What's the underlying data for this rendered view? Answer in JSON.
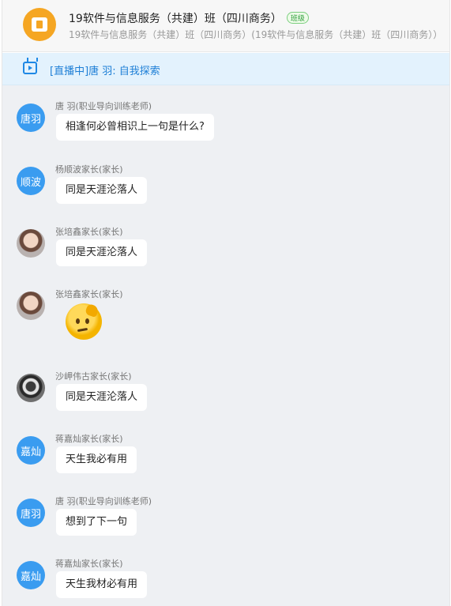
{
  "header": {
    "title": "19软件与信息服务（共建）班（四川商务）",
    "badge": "班级",
    "subtitle": "19软件与信息服务（共建）班（四川商务）(19软件与信息服务（共建）班（四川商务））",
    "icon": "book-icon",
    "accent_color": "#f5a623"
  },
  "live": {
    "text": "[直播中]唐 羽: 自我探索",
    "icon": "tv-icon",
    "color": "#1e7fd6"
  },
  "messages": [
    {
      "avatar_text": "唐羽",
      "sender": "唐 羽(职业导向训练老师)",
      "content": "相逢何必曾相识上一句是什么?"
    },
    {
      "avatar_text": "顺波",
      "sender": "杨顺波家长(家长)",
      "content": "同是天涯沦落人"
    },
    {
      "avatar_text": "",
      "sender": "张培鑫家长(家长)",
      "content": "同是天涯沦落人"
    },
    {
      "avatar_text": "",
      "sender": "张培鑫家长(家长)",
      "content": "",
      "sticker": "thinking-face-emoji"
    },
    {
      "avatar_text": "",
      "sender": "沙岬伟古家长(家长)",
      "content": "同是天涯沦落人"
    },
    {
      "avatar_text": "嘉灿",
      "sender": "蒋嘉灿家长(家长)",
      "content": "天生我必有用"
    },
    {
      "avatar_text": "唐羽",
      "sender": "唐 羽(职业导向训练老师)",
      "content": "想到了下一句"
    },
    {
      "avatar_text": "嘉灿",
      "sender": "蒋嘉灿家长(家长)",
      "content": "天生我材必有用"
    }
  ]
}
